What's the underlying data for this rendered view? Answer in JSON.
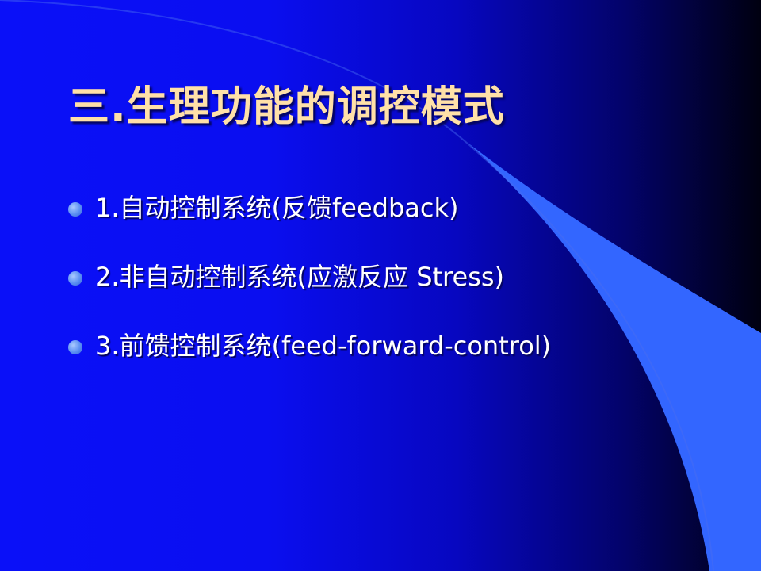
{
  "slide": {
    "title": "三.生理功能的调控模式",
    "bullets": [
      {
        "text": "1.自动控制系统(反馈feedback)"
      },
      {
        "text": "2.非自动控制系统(应激反应 Stress)"
      },
      {
        "text": "3.前馈控制系统(feed-forward-control)"
      }
    ]
  },
  "colors": {
    "title": "#FFE0A8",
    "text": "#FFFFFF",
    "bullet": "#5A8EF2",
    "swoosh": "#3366FF"
  },
  "icons": {
    "bullet": "filled-circle-bullet"
  }
}
